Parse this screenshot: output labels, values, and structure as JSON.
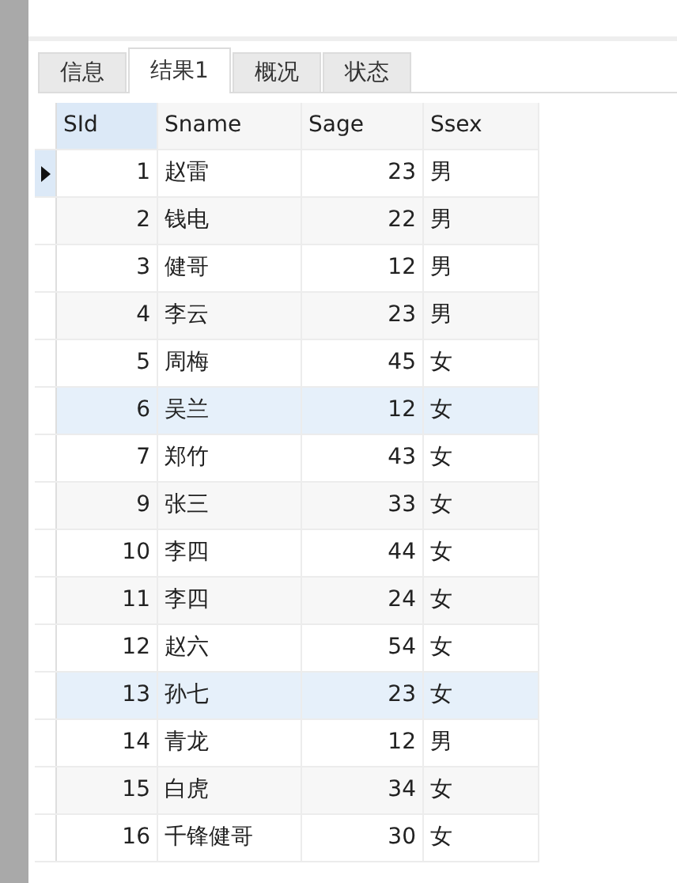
{
  "tabs": [
    {
      "label": "信息",
      "selected": false
    },
    {
      "label": "结果1",
      "selected": true
    },
    {
      "label": "概况",
      "selected": false
    },
    {
      "label": "状态",
      "selected": false
    }
  ],
  "table": {
    "columns": [
      {
        "label": "SId",
        "selected": true
      },
      {
        "label": "Sname",
        "selected": false
      },
      {
        "label": "Sage",
        "selected": false
      },
      {
        "label": "Ssex",
        "selected": false
      }
    ],
    "rows": [
      {
        "cells": [
          "1",
          "赵雷",
          "23",
          "男"
        ],
        "selected": true,
        "highlighted": false
      },
      {
        "cells": [
          "2",
          "钱电",
          "22",
          "男"
        ],
        "selected": false,
        "highlighted": false
      },
      {
        "cells": [
          "3",
          "健哥",
          "12",
          "男"
        ],
        "selected": false,
        "highlighted": false
      },
      {
        "cells": [
          "4",
          "李云",
          "23",
          "男"
        ],
        "selected": false,
        "highlighted": false
      },
      {
        "cells": [
          "5",
          "周梅",
          "45",
          "女"
        ],
        "selected": false,
        "highlighted": false
      },
      {
        "cells": [
          "6",
          "吴兰",
          "12",
          "女"
        ],
        "selected": false,
        "highlighted": true
      },
      {
        "cells": [
          "7",
          "郑竹",
          "43",
          "女"
        ],
        "selected": false,
        "highlighted": false
      },
      {
        "cells": [
          "9",
          "张三",
          "33",
          "女"
        ],
        "selected": false,
        "highlighted": false
      },
      {
        "cells": [
          "10",
          "李四",
          "44",
          "女"
        ],
        "selected": false,
        "highlighted": false
      },
      {
        "cells": [
          "11",
          "李四",
          "24",
          "女"
        ],
        "selected": false,
        "highlighted": false
      },
      {
        "cells": [
          "12",
          "赵六",
          "54",
          "女"
        ],
        "selected": false,
        "highlighted": false
      },
      {
        "cells": [
          "13",
          "孙七",
          "23",
          "女"
        ],
        "selected": false,
        "highlighted": true
      },
      {
        "cells": [
          "14",
          "青龙",
          "12",
          "男"
        ],
        "selected": false,
        "highlighted": false
      },
      {
        "cells": [
          "15",
          "白虎",
          "34",
          "女"
        ],
        "selected": false,
        "highlighted": false
      },
      {
        "cells": [
          "16",
          "千锋健哥",
          "30",
          "女"
        ],
        "selected": false,
        "highlighted": false
      }
    ]
  }
}
